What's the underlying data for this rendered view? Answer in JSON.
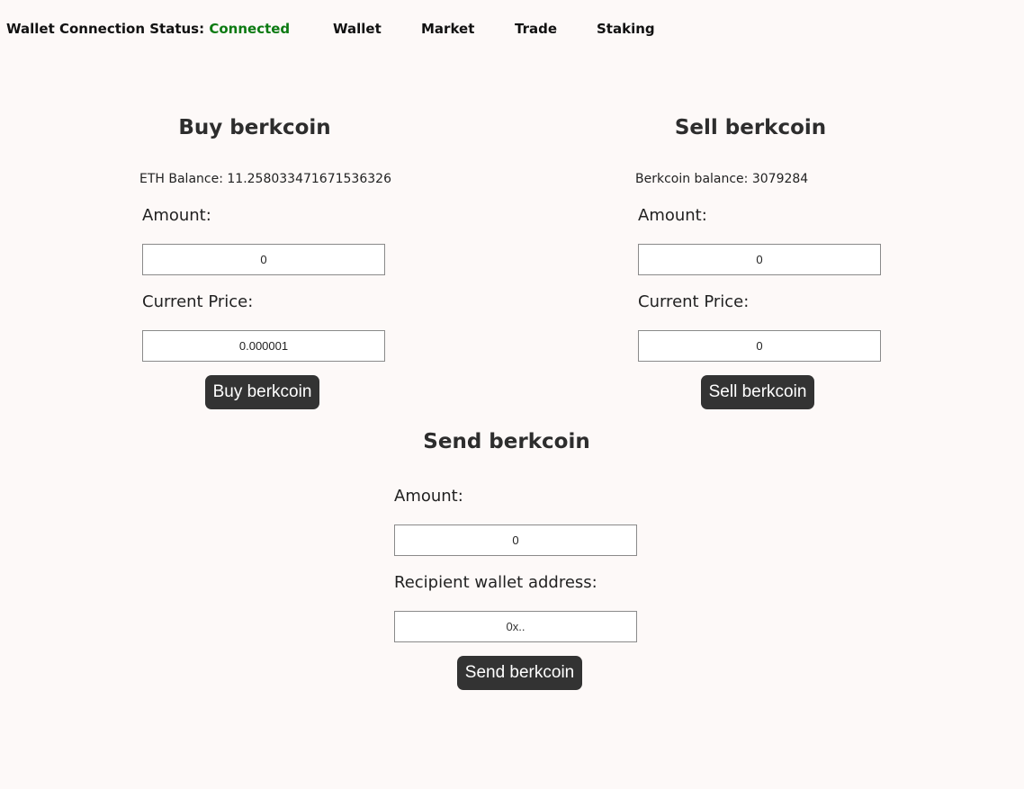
{
  "header": {
    "status_label": "Wallet Connection Status:",
    "status_value": "Connected",
    "status_color": "#0c7a12",
    "nav": [
      "Wallet",
      "Market",
      "Trade",
      "Staking"
    ]
  },
  "buy": {
    "title": "Buy berkcoin",
    "balance": "ETH Balance: 11.258033471671536326",
    "amount_label": "Amount:",
    "amount_value": "0",
    "price_label": "Current Price:",
    "price_value": "0.000001",
    "button": "Buy berkcoin"
  },
  "sell": {
    "title": "Sell berkcoin",
    "balance": "Berkcoin balance: 3079284",
    "amount_label": "Amount:",
    "amount_value": "0",
    "price_label": "Current Price:",
    "price_value": "0",
    "button": "Sell berkcoin"
  },
  "send": {
    "title": "Send berkcoin",
    "amount_label": "Amount:",
    "amount_value": "0",
    "recipient_label": "Recipient wallet address:",
    "recipient_placeholder": "0x..",
    "button": "Send berkcoin"
  },
  "colors": {
    "background": "#fdf9f8",
    "button": "#333333",
    "connected": "#0c7a12"
  }
}
